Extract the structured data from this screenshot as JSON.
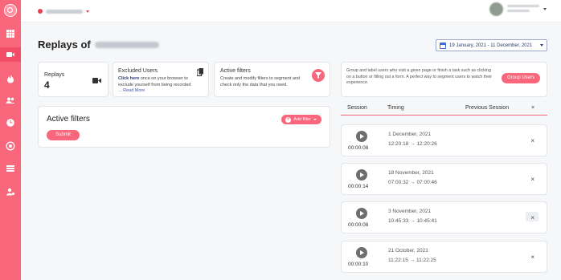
{
  "page": {
    "title": "Replays of",
    "date_range": "19 January, 2021 - 11 December, 2021"
  },
  "cards": {
    "replays": {
      "label": "Replays",
      "value": "4"
    },
    "excluded": {
      "title": "Excluded Users",
      "link": "Click here",
      "text": " once on your browser to exclude yourself from being recorded",
      "more": "... Read More"
    },
    "filters": {
      "title": "Active filters",
      "text": "Create and modify filters to segment and check only the data that you need."
    },
    "group": {
      "text": "Group and label users who visit a given page or finish a task such as clicking on a button or filling out a form. A perfect way to segment users to watch their experience.",
      "button": "Group Users"
    }
  },
  "active_filters": {
    "title": "Active filters",
    "add_button": "Add filter",
    "submit_button": "Submit"
  },
  "sessions_table": {
    "headers": [
      "Session",
      "Timing",
      "Previous Session",
      "×"
    ],
    "rows": [
      {
        "duration": "00:00:08",
        "date": "1 December, 2021",
        "start": "12:20:18",
        "end": "12:20:26",
        "close": "×"
      },
      {
        "duration": "00:00:14",
        "date": "18 November, 2021",
        "start": "07:00:32",
        "end": "07:00:46",
        "close": "×"
      },
      {
        "duration": "00:00:08",
        "date": "3 November, 2021",
        "start": "10:45:33",
        "end": "10:45:41",
        "close": "×"
      },
      {
        "duration": "00:00:10",
        "date": "21 October, 2021",
        "start": "11:22:15",
        "end": "11:22:25",
        "close": "×"
      }
    ]
  },
  "icons": {
    "sidebar": [
      "logo-icon",
      "dashboard-grid-icon",
      "video-camera-icon",
      "flame-icon",
      "users-icon",
      "clock-icon",
      "target-icon",
      "table-icon",
      "user-settings-icon"
    ]
  },
  "colors": {
    "accent": "#f9677d",
    "accent_dark": "#f24d68",
    "date_picker_border": "#9aa6c6"
  }
}
